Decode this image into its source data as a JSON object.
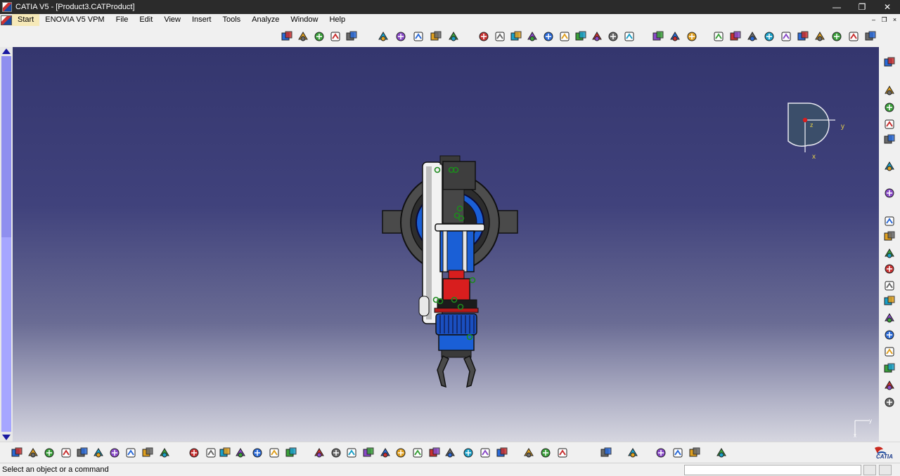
{
  "window": {
    "title": "CATIA V5 - [Product3.CATProduct]",
    "controls": [
      "—",
      "❐",
      "✕"
    ]
  },
  "menu": {
    "items": [
      "Start",
      "ENOVIA V5 VPM",
      "File",
      "Edit",
      "View",
      "Insert",
      "Tools",
      "Analyze",
      "Window",
      "Help"
    ],
    "doc_controls": [
      "–",
      "❐",
      "×"
    ]
  },
  "compass": {
    "axis_y": "y",
    "axis_x": "x",
    "axis_z": "z"
  },
  "status": {
    "message": "Select an object or a command",
    "command_value": ""
  },
  "brand": {
    "logo_text": "CATIA"
  },
  "colors": {
    "viewport_top": "#34366e",
    "viewport_bottom": "#d6d6e0",
    "part_blue": "#1a5fd6",
    "part_red": "#d81e1e",
    "part_gray": "#4a4a4a"
  },
  "icons": {
    "top": [
      "product-icon",
      "assembly-icon",
      "component-icon",
      "part-icon",
      "tree-icon",
      "measure-icon",
      "annotation-icon",
      "search-icon",
      "section-icon",
      "clash-icon",
      "constraint-icon",
      "fix-icon",
      "coincidence-icon",
      "contact-icon",
      "offset-icon",
      "angle-icon",
      "reconnect-icon",
      "update-icon",
      "multi-constraint-icon",
      "swap-icon",
      "explode-icon",
      "snap-icon",
      "iso-view-icon",
      "front-view-icon",
      "back-view-icon",
      "left-view-icon",
      "right-view-icon",
      "top-view-icon",
      "bottom-view-icon",
      "render-icon",
      "hide-icon",
      "swap-visible-icon",
      "more-icon"
    ],
    "right": [
      "settings-icon",
      "sketch-1-icon",
      "sketch-2-icon",
      "sketch-3-icon",
      "sketch-4-icon",
      "select-icon",
      "move-icon",
      "manipulate-icon",
      "snap-icon",
      "smart-move-icon",
      "explode-icon",
      "stop-icon",
      "analyze-icon",
      "clash-icon",
      "section-icon",
      "distance-icon",
      "measure-icon",
      "bom-icon",
      "catalog-icon",
      "tools-icon"
    ],
    "bottom": [
      "new-icon",
      "open-icon",
      "save-icon",
      "print-icon",
      "cut-icon",
      "copy-icon",
      "paste-icon",
      "undo-icon",
      "redo-icon",
      "whats-this-icon",
      "formula-icon",
      "comment-icon",
      "link-icon",
      "table-icon",
      "tree-icon",
      "catalog-icon",
      "knowledge-icon",
      "fly-icon",
      "fit-all-icon",
      "pan-icon",
      "rotate-icon",
      "zoom-in-icon",
      "zoom-out-icon",
      "normal-view-icon",
      "multi-view-icon",
      "iso-icon",
      "shading-icon",
      "hide-show-icon",
      "swap-icon",
      "multi-2-icon",
      "multi-3-icon",
      "camera-icon",
      "render-icon",
      "manipulate-icon",
      "cylinder-icon",
      "spiral-icon",
      "eraser-icon",
      "grid-icon"
    ]
  }
}
